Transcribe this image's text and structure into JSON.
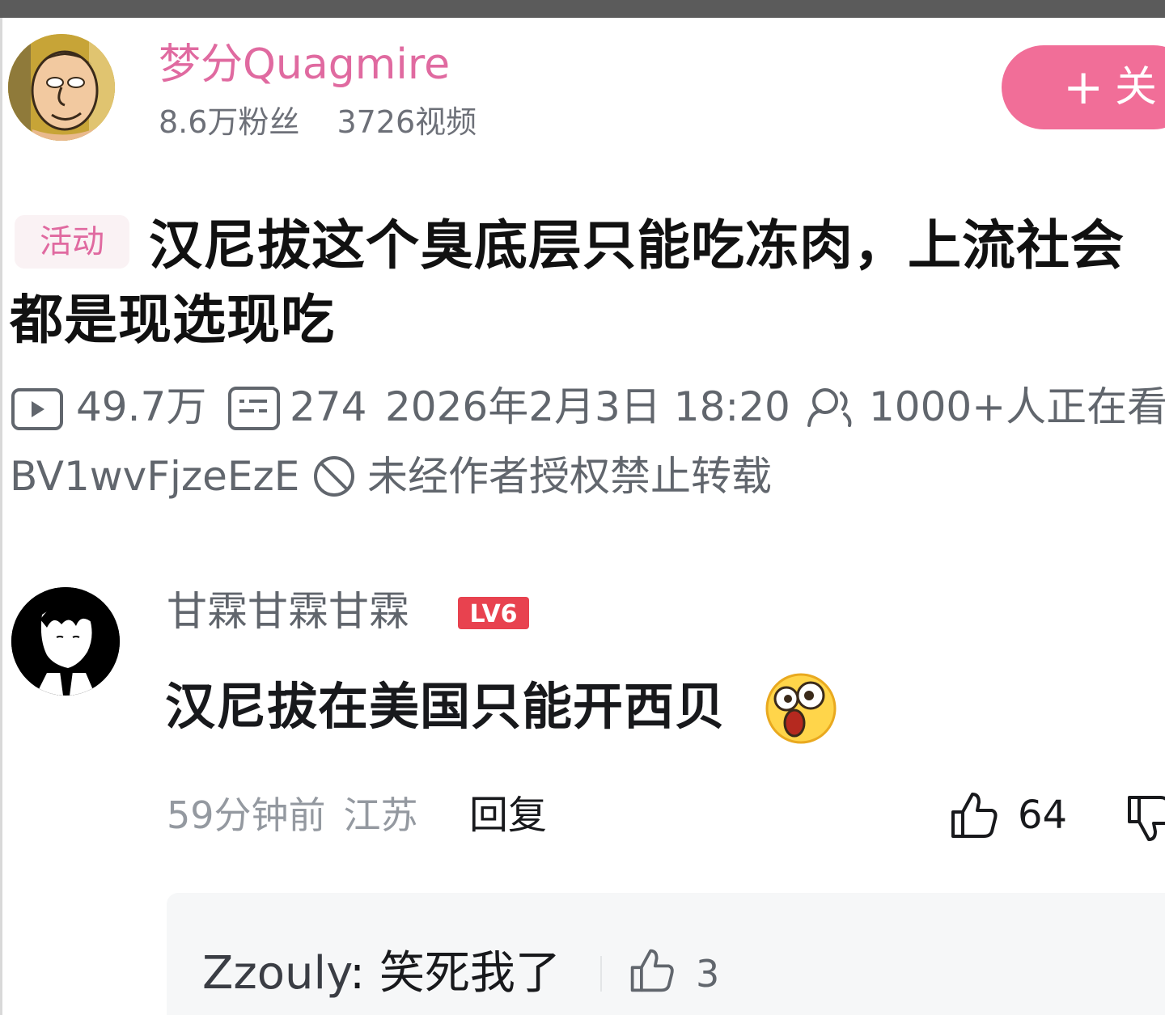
{
  "uploader": {
    "name": "梦分Quagmire",
    "followers": "8.6万粉丝",
    "videos": "3726视频",
    "follow_plus": "+",
    "follow_label": "关"
  },
  "video": {
    "tag": "活动",
    "title": "汉尼拔这个臭底层只能吃冻肉，上流社会都是现选现吃",
    "views": "49.7万",
    "danmaku": "274",
    "datetime": "2026年2月3日 18:20",
    "watching": "1000+人正在看",
    "bvid": "BV1wvFjzeEzE",
    "copyright": "未经作者授权禁止转载"
  },
  "comment": {
    "user": "甘霖甘霖甘霖",
    "level": "LV6",
    "text": "汉尼拔在美国只能开西贝",
    "time": "59分钟前",
    "location": "江苏",
    "reply_label": "回复",
    "likes": "64",
    "emoji": "shocked-face-icon"
  },
  "sub_reply": {
    "user": "Zzouly",
    "text": "笑死我了",
    "likes": "3"
  },
  "colors": {
    "accent_pink": "#f16e98",
    "name_pink": "#e06aa0",
    "meta_gray": "#61666d",
    "level_red": "#e8424f"
  }
}
